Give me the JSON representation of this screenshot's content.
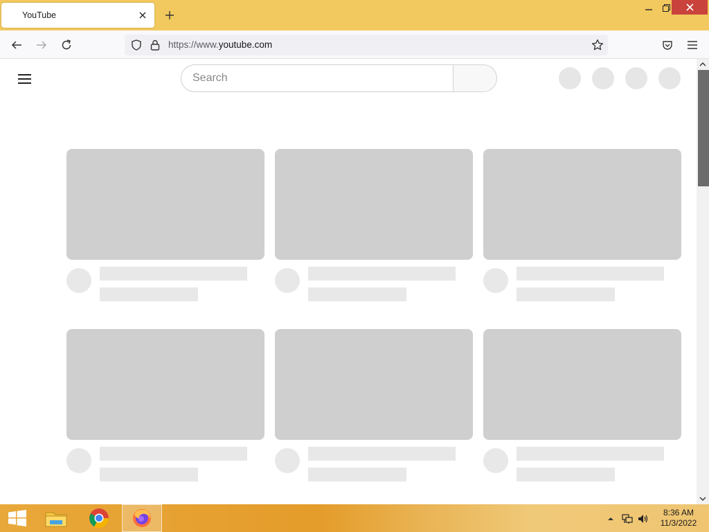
{
  "browser": {
    "tab": {
      "title": "YouTube"
    },
    "url": {
      "scheme": "https://www.",
      "host": "youtube.com"
    }
  },
  "page": {
    "search": {
      "placeholder": "Search"
    },
    "card_rows": 2,
    "cards_per_row": 3
  },
  "taskbar": {
    "clock": {
      "time": "8:36 AM",
      "date": "11/3/2022"
    },
    "apps": [
      "file-explorer-icon",
      "chrome-icon",
      "firefox-icon"
    ]
  },
  "colors": {
    "titlebar": "#f2c95f",
    "skeleton_thumb": "#cfcfcf",
    "skeleton_line": "#e8e8e8",
    "close_button": "#c9423c"
  }
}
